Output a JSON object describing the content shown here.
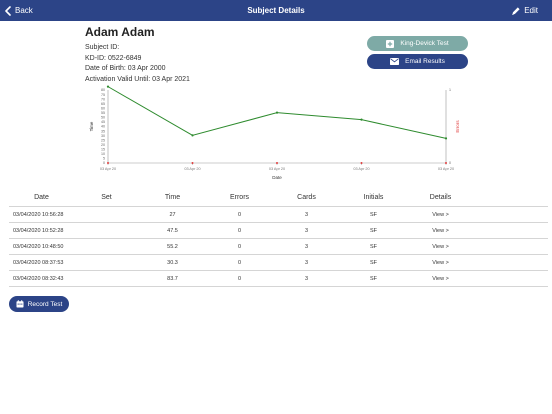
{
  "navbar": {
    "back_label": "Back",
    "title": "Subject Details",
    "edit_label": "Edit",
    "bg_color": "#2c4487"
  },
  "subject": {
    "name": "Adam Adam",
    "subject_id": "Subject ID:",
    "kd_id": "KD-ID: 0522-6849",
    "dob": "Date of Birth: 03 Apr 2000",
    "activation": "Activation Valid Until: 03 Apr 2021"
  },
  "actions": {
    "kd_test_label": "King-Devick Test",
    "email_label": "Email Results",
    "record_label": "Record Test",
    "kd_color": "#7eaaa6",
    "primary_color": "#2c4487"
  },
  "chart_data": {
    "type": "line",
    "xlabel": "Date",
    "ylabel": "Time",
    "y2label": "Errors",
    "ylim": [
      0,
      80
    ],
    "y2lim": [
      0,
      1
    ],
    "yticks": [
      "0",
      "5",
      "10",
      "15",
      "20",
      "25",
      "30",
      "35",
      "40",
      "45",
      "50",
      "55",
      "60",
      "65",
      "70",
      "75",
      "80"
    ],
    "y2ticks": [
      "0",
      "1"
    ],
    "x": [
      "03 Apr 20",
      "03 Apr 20",
      "03 Apr 20",
      "03 Apr 20",
      "03 Apr 20"
    ],
    "series": [
      {
        "axis": "left",
        "color": "#2e8b2e",
        "values": [
          83.7,
          30.3,
          55.2,
          47.5,
          27
        ]
      },
      {
        "axis": "right",
        "color": "#e03a3a",
        "values": [
          0,
          0,
          0,
          0,
          0
        ]
      }
    ],
    "grid": false
  },
  "table": {
    "headers": [
      "Date",
      "Set",
      "Time",
      "Errors",
      "Cards",
      "Initials",
      "Details"
    ],
    "rows": [
      [
        "03/04/2020 10:56:28",
        "",
        "27",
        "0",
        "3",
        "SF",
        "View >"
      ],
      [
        "03/04/2020 10:52:28",
        "",
        "47.5",
        "0",
        "3",
        "SF",
        "View >"
      ],
      [
        "03/04/2020 10:48:50",
        "",
        "55.2",
        "0",
        "3",
        "SF",
        "View >"
      ],
      [
        "03/04/2020 08:37:53",
        "",
        "30.3",
        "0",
        "3",
        "SF",
        "View >"
      ],
      [
        "03/04/2020 08:32:43",
        "",
        "83.7",
        "0",
        "3",
        "SF",
        "View >"
      ]
    ]
  }
}
